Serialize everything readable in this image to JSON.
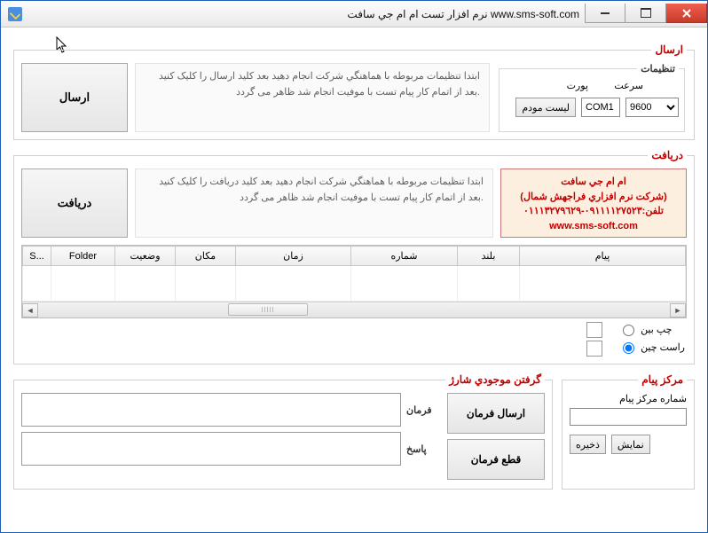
{
  "window": {
    "title": "نرم افزار تست ام ام جي سافت  www.sms-soft.com"
  },
  "send": {
    "legend": "ارسال",
    "button": "ارسال",
    "instruction": "ابتدا تنظیمات مربوطه با هماهنگي شرکت  انجام دهید بعد کلید ارسال را کلیک کنید .بعد از اتمام کار پیام تست با موفیت انجام شد ظاهر می گردد",
    "settings_legend": "تنظیمات",
    "port_label": "پورت",
    "speed_label": "سرعت",
    "modem_list_btn": "ليست مودم",
    "port_value": "COM1",
    "speed_value": "9600"
  },
  "receive": {
    "legend": "دریافت",
    "button": "دریافت",
    "instruction": "ابتدا تنظیمات مربوطه با هماهنگي شرکت  انجام دهید بعد کلید دریافت را کلیک کنید .بعد از اتمام کار پیام تست با موفیت انجام شد ظاهر می گردد",
    "company_l1": "ام ام جي سافت",
    "company_l2": "(شرکت نرم افزاري فراجهش شمال)",
    "company_l3": "تلفن:٠٩١١١١٢٧٥٢٣-٠١١١٣٢٧٩٦٢٩",
    "company_l4": "www.sms-soft.com"
  },
  "grid": {
    "headers": [
      "S...",
      "Folder",
      "وضعيت",
      "مکان",
      "زمان",
      "شماره",
      "بلند",
      "پيام"
    ]
  },
  "align": {
    "left": "چپ بين",
    "right": "راست چين"
  },
  "msgcenter": {
    "legend": "مرکز پيام",
    "label": "شماره مرکز پيام",
    "value": "",
    "show_btn": "نمايش",
    "save_btn": "ذخيره"
  },
  "charge": {
    "legend": "گرفتن موجودي شارژ",
    "cmd_label": "فرمان",
    "ans_label": "پاسخ",
    "send_cmd_btn": "ارسال فرمان",
    "stop_cmd_btn": "قطع فرمان"
  }
}
